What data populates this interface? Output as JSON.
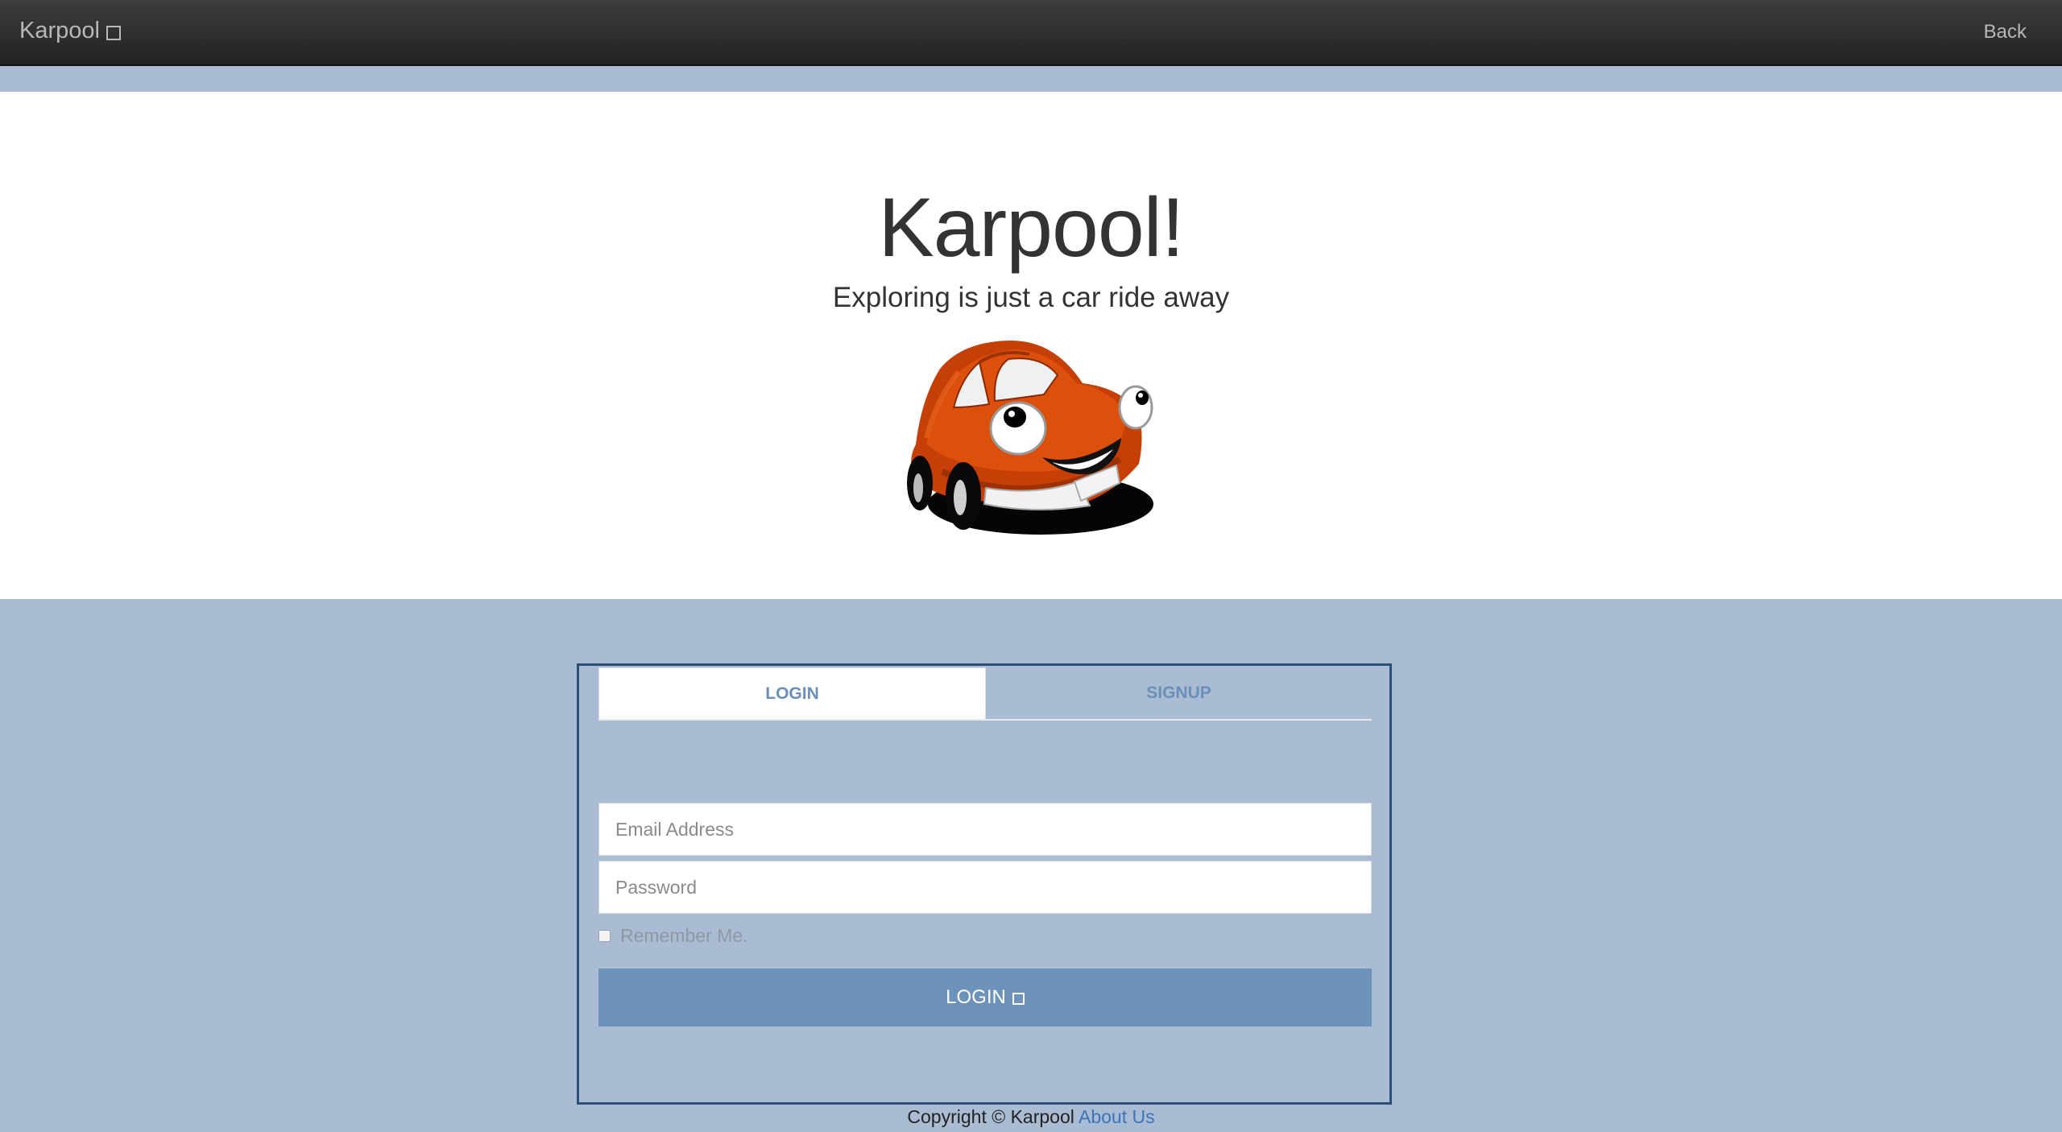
{
  "navbar": {
    "brand": "Karpool",
    "brand_icon": "square-icon",
    "back_label": "Back"
  },
  "hero": {
    "title": "Karpool!",
    "subtitle": "Exploring is just a car ride away",
    "image": "cartoon-car-illustration"
  },
  "auth": {
    "tabs": [
      {
        "label": "LOGIN",
        "active": true
      },
      {
        "label": "SIGNUP",
        "active": false
      }
    ],
    "email_placeholder": "Email Address",
    "password_placeholder": "Password",
    "remember_label": "Remember Me.",
    "remember_checked": false,
    "submit_label": "LOGIN",
    "submit_icon": "square-icon"
  },
  "footer": {
    "copyright": "Copyright © Karpool",
    "about_link": "About Us"
  },
  "colors": {
    "page_background": "#a9bcd3",
    "navbar": "#2b2b2b",
    "accent": "#6e93ba",
    "border": "#2d4f75",
    "car_body": "#d94b0a"
  }
}
